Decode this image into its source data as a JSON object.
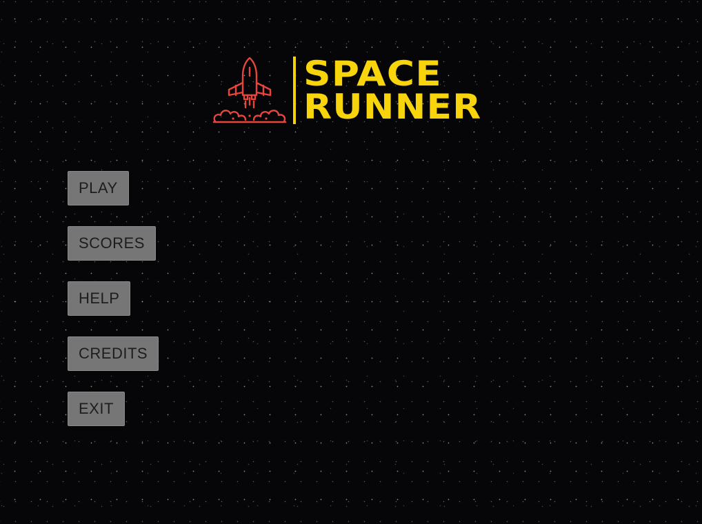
{
  "logo": {
    "line1": "SPACE",
    "line2": "RUNNER",
    "icon": "space-shuttle-icon",
    "colors": {
      "title": "#f7d40c",
      "icon": "#e8453c"
    }
  },
  "menu": {
    "items": [
      {
        "label": "PLAY"
      },
      {
        "label": "SCORES"
      },
      {
        "label": "HELP"
      },
      {
        "label": "CREDITS"
      },
      {
        "label": "EXIT"
      }
    ]
  },
  "colors": {
    "background": "#060608",
    "button_bg": "#767676",
    "button_text": "#1d1d1d"
  }
}
